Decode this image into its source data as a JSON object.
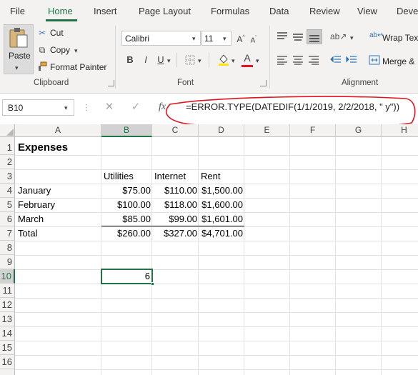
{
  "tabs": [
    "File",
    "Home",
    "Insert",
    "Page Layout",
    "Formulas",
    "Data",
    "Review",
    "View",
    "Deve"
  ],
  "ribbon": {
    "clipboard": {
      "paste": "Paste",
      "cut": "Cut",
      "copy": "Copy",
      "format_painter": "Format Painter",
      "label": "Clipboard"
    },
    "font": {
      "name": "Calibri",
      "size": "11",
      "bold": "B",
      "italic": "I",
      "underline": "U",
      "font_color_glyph": "A",
      "label": "Font"
    },
    "alignment": {
      "wrap_text": "Wrap Tex",
      "merge": "Merge &",
      "label": "Alignment"
    }
  },
  "formula_bar": {
    "name_box": "B10",
    "fx": "fx",
    "formula": "=ERROR.TYPE(DATEDIF(1/1/2019, 2/2/2018, \" y\"))"
  },
  "grid": {
    "columns": [
      "A",
      "B",
      "C",
      "D",
      "E",
      "F",
      "G",
      "H"
    ],
    "rows": [
      "1",
      "2",
      "3",
      "4",
      "5",
      "6",
      "7",
      "8",
      "9",
      "10",
      "11",
      "12",
      "13",
      "14",
      "15",
      "16"
    ],
    "selected_cell": "B10",
    "title": "Expenses",
    "headers": [
      "Utilities",
      "Internet",
      "Rent"
    ],
    "data_rows": [
      {
        "label": "January",
        "values": [
          "$75.00",
          "$110.00",
          "$1,500.00"
        ]
      },
      {
        "label": "February",
        "values": [
          "$100.00",
          "$118.00",
          "$1,600.00"
        ]
      },
      {
        "label": "March",
        "values": [
          "$85.00",
          "$99.00",
          "$1,601.00"
        ]
      },
      {
        "label": "Total",
        "values": [
          "$260.00",
          "$327.00",
          "$4,701.00"
        ]
      }
    ],
    "b10_value": "6"
  },
  "colors": {
    "accent": "#217346",
    "annotation": "#e0141e",
    "font_color_bar": "#e81123",
    "fill_color_bar": "#ffe600"
  }
}
